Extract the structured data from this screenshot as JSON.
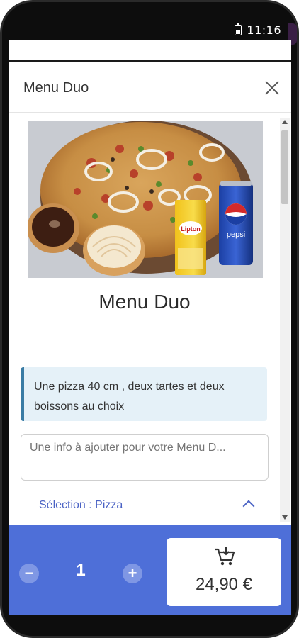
{
  "status_bar": {
    "time": "11:16"
  },
  "modal": {
    "title": "Menu Duo",
    "product_name": "Menu Duo",
    "description": "Une pizza 40 cm , deux tartes et deux boissons au choix",
    "info_placeholder": "Une info à ajouter pour votre Menu D...",
    "selection_label": "Sélection : Pizza"
  },
  "image_labels": {
    "drink1": "Lipton",
    "drink2": "pepsi"
  },
  "cart": {
    "quantity": "1",
    "minus": "−",
    "plus": "+",
    "price": "24,90 €"
  },
  "colors": {
    "accent": "#4e6fd8",
    "link": "#4a62c4",
    "description_bg": "#e5f1f8",
    "description_border": "#3a7ca5"
  },
  "icons": [
    "battery-icon",
    "close-icon",
    "chevron-up-icon",
    "cart-icon",
    "minus-icon",
    "plus-icon"
  ]
}
